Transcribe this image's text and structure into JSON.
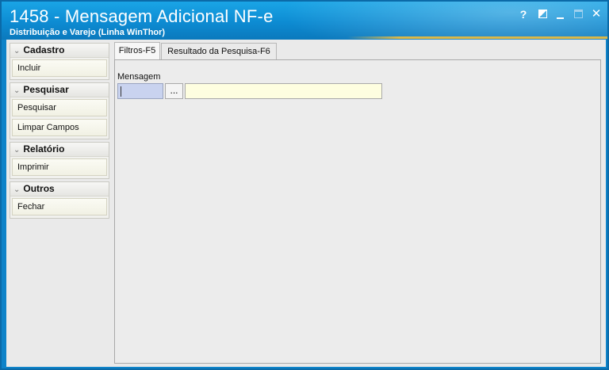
{
  "window": {
    "title": "1458 - Mensagem Adicional NF-e",
    "subtitle": "Distribuição e Varejo (Linha WinThor)",
    "controls": {
      "help": "?",
      "close": "✕"
    }
  },
  "sidebar": {
    "groups": [
      {
        "label": "Cadastro",
        "items": [
          {
            "label": "Incluir"
          }
        ]
      },
      {
        "label": "Pesquisar",
        "items": [
          {
            "label": "Pesquisar"
          },
          {
            "label": "Limpar Campos"
          }
        ]
      },
      {
        "label": "Relatório",
        "items": [
          {
            "label": "Imprimir"
          }
        ]
      },
      {
        "label": "Outros",
        "items": [
          {
            "label": "Fechar"
          }
        ]
      }
    ]
  },
  "tabs": [
    {
      "label": "Filtros-F5",
      "active": true
    },
    {
      "label": "Resultado da Pesquisa-F6",
      "active": false
    }
  ],
  "filters": {
    "mensagem_label": "Mensagem",
    "code_value": "",
    "lookup_button": "...",
    "description_value": ""
  },
  "colors": {
    "titlebar": "#0d8bd2",
    "code_field_bg": "#c9d3ef",
    "description_field_bg": "#fefee0"
  }
}
